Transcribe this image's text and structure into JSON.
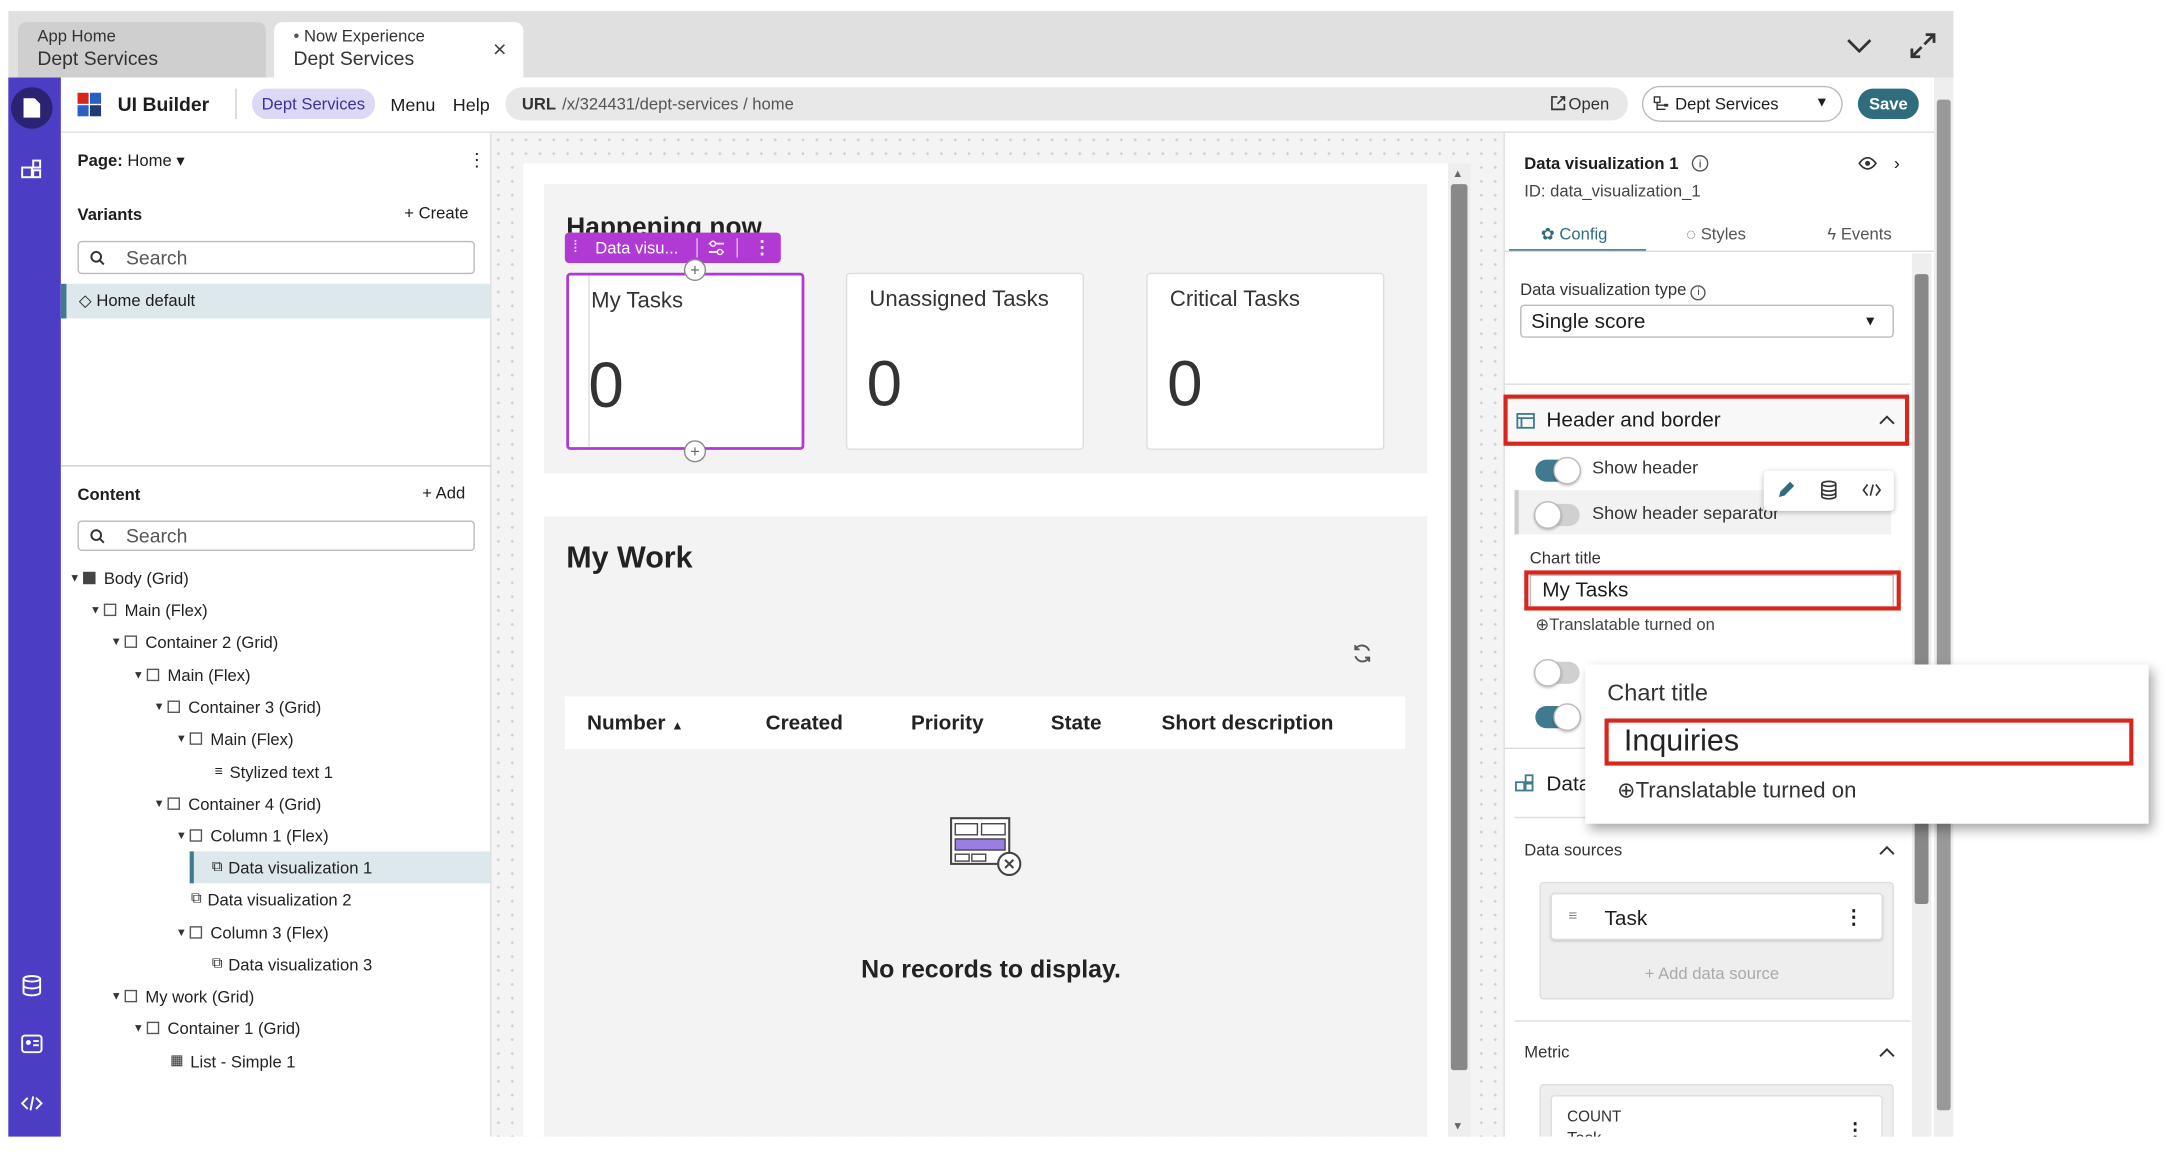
{
  "browser": {
    "tabs": [
      {
        "small": "App Home",
        "main": "Dept Services"
      },
      {
        "small": "Now Experience",
        "main": "Dept Services"
      }
    ],
    "close": "×"
  },
  "toolbar": {
    "app_name": "UI Builder",
    "app_pill": "Dept Services",
    "menu": "Menu",
    "help": "Help",
    "url_label": "URL",
    "url": "/x/324431/dept-services / home",
    "open": "Open",
    "scope": "Dept Services",
    "save": "Save"
  },
  "left": {
    "page_label": "Page:",
    "page_name": "Home",
    "variants": "Variants",
    "create": "Create",
    "search1": "Search",
    "variant_item": "Home default",
    "content": "Content",
    "add": "Add",
    "search2": "Search",
    "tree": [
      "Body (Grid)",
      "Main (Flex)",
      "Container 2 (Grid)",
      "Main (Flex)",
      "Container 3 (Grid)",
      "Main (Flex)",
      "Stylized text 1",
      "Container 4 (Grid)",
      "Column 1 (Flex)",
      "Data visualization 1",
      "Data visualization 2",
      "Column 3 (Flex)",
      "Data visualization 3",
      "My work (Grid)",
      "Container 1 (Grid)",
      "List - Simple 1"
    ]
  },
  "canvas": {
    "happening": "Happening now",
    "chip": "Data visu...",
    "cards": [
      {
        "title": "My Tasks",
        "value": "0"
      },
      {
        "title": "Unassigned Tasks",
        "value": "0"
      },
      {
        "title": "Critical Tasks",
        "value": "0"
      }
    ],
    "my_work": "My Work",
    "columns": [
      "Number",
      "Created",
      "Priority",
      "State",
      "Short description"
    ],
    "sort_arrow": "▲",
    "empty": "No records to display."
  },
  "right": {
    "title": "Data visualization 1",
    "id": "ID: data_visualization_1",
    "tabs": [
      "Config",
      "Styles",
      "Events"
    ],
    "dv_type_label": "Data visualization type",
    "dv_type": "Single score",
    "section_header": "Header and border",
    "show_header": "Show header",
    "show_sep": "Show header separator",
    "chart_title_label": "Chart title",
    "chart_title_value": "My Tasks",
    "translatable": "Translatable turned on",
    "data_section": "Data",
    "data_sources": "Data sources",
    "source": "Task",
    "add_source": "+ Add data source",
    "metric": "Metric",
    "count": "COUNT",
    "count_sub": "Task"
  },
  "popup": {
    "label": "Chart title",
    "value": "Inquiries",
    "translatable": "Translatable turned on"
  },
  "colors": {
    "sidebar": "#4b3ec4",
    "accent": "#3f7a8f",
    "purple": "#b23ad4",
    "highlight": "#d9261c",
    "save": "#2e6c7e"
  }
}
